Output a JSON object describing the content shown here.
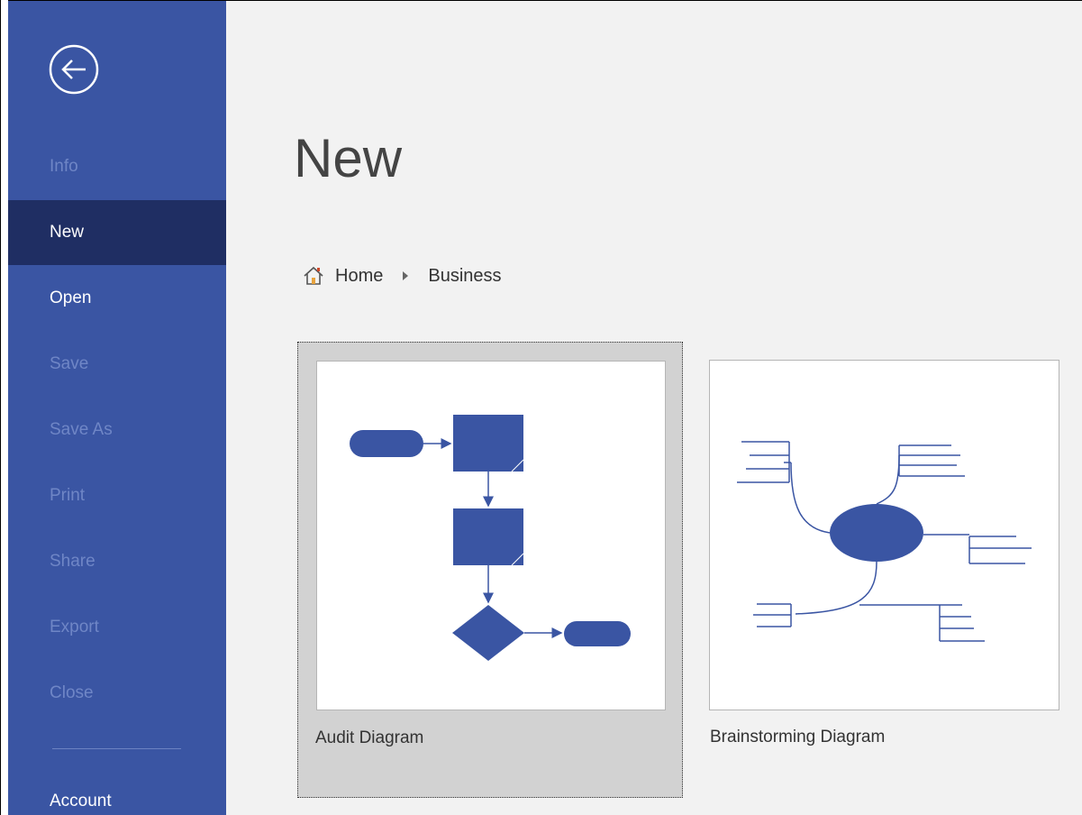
{
  "sidebar": {
    "back_button": "back-arrow-icon",
    "items": [
      {
        "label": "Info",
        "state": "disabled"
      },
      {
        "label": "New",
        "state": "selected"
      },
      {
        "label": "Open",
        "state": "enabled"
      },
      {
        "label": "Save",
        "state": "disabled"
      },
      {
        "label": "Save As",
        "state": "disabled"
      },
      {
        "label": "Print",
        "state": "disabled"
      },
      {
        "label": "Share",
        "state": "disabled"
      },
      {
        "label": "Export",
        "state": "disabled"
      },
      {
        "label": "Close",
        "state": "disabled"
      },
      {
        "label": "Account",
        "state": "enabled"
      }
    ]
  },
  "main": {
    "title": "New",
    "breadcrumb": {
      "home_icon": "home-icon",
      "items": [
        "Home",
        "Business"
      ]
    },
    "templates": [
      {
        "name": "Audit Diagram",
        "selected": true
      },
      {
        "name": "Brainstorming Diagram",
        "selected": false
      }
    ]
  },
  "colors": {
    "sidebar": "#3a55a3",
    "sidebar_selected": "#1f2e63",
    "sidebar_disabled_text": "#6f86c6",
    "background": "#f2f2f2",
    "shape_fill": "#3a55a3",
    "selected_card": "#d2d2d2"
  }
}
